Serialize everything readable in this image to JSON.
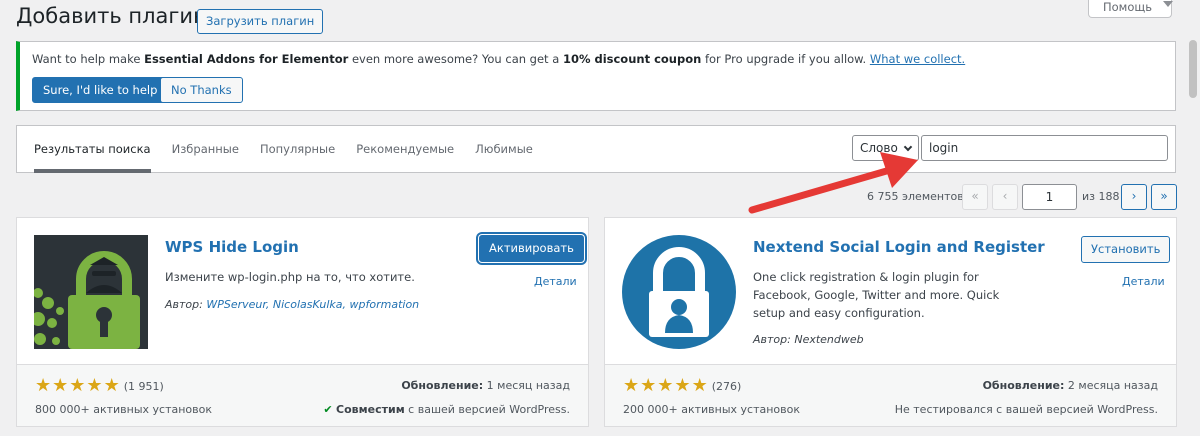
{
  "header": {
    "title": "Добавить плагины",
    "upload_label": "Загрузить плагин",
    "help_label": "Помощь"
  },
  "notice": {
    "text_1": "Want to help make ",
    "bold_1": "Essential Addons for Elementor",
    "text_2": " even more awesome? You can get a ",
    "bold_2": "10% discount coupon",
    "text_3": " for Pro upgrade if you allow. ",
    "link": "What we collect.",
    "accept_label": "Sure, I'd like to help",
    "decline_label": "No Thanks",
    "accent_color": "#00a32a"
  },
  "filter": {
    "tabs": [
      {
        "label": "Результаты поиска",
        "active": true
      },
      {
        "label": "Избранные",
        "active": false
      },
      {
        "label": "Популярные",
        "active": false
      },
      {
        "label": "Рекомендуемые",
        "active": false
      },
      {
        "label": "Любимые",
        "active": false
      }
    ],
    "type_select": "Слово",
    "search_value": "login"
  },
  "pagination": {
    "count": "6 755 элементов",
    "first": "«",
    "prev": "‹",
    "current_page": "1",
    "of_label": "из 188",
    "next": "›",
    "last": "»"
  },
  "plugins": [
    {
      "name": "WPS Hide Login",
      "action": "Активировать",
      "details": "Детали",
      "description": "Измените wp-login.php на то, что хотите.",
      "author_prefix": "Автор: ",
      "author": "WPServeur, NicolasKulka, wpformation",
      "rating": 5,
      "rating_count": "(1 951)",
      "installs": "800 000+ активных установок",
      "updated_label": "Обновление:",
      "updated": " 1 месяц назад",
      "compat_bold": "Совместим",
      "compat_text": " с вашей версией WordPress.",
      "icon": "padlock-spy-icon"
    },
    {
      "name": "Nextend Social Login and Register",
      "action": "Установить",
      "details": "Детали",
      "description": "One click registration & login plugin for Facebook, Google, Twitter and more. Quick setup and easy configuration.",
      "author_prefix": "Автор: ",
      "author": "Nextendweb",
      "rating": 5,
      "rating_count": "(276)",
      "installs": "200 000+ активных установок",
      "updated_label": "Обновление:",
      "updated": " 2 месяца назад",
      "compat_text": "Не тестировался с вашей версией WordPress.",
      "icon": "padlock-user-icon"
    }
  ],
  "colors": {
    "brand": "#2271b1",
    "star": "#dba617",
    "annotation_arrow": "#e53935"
  }
}
